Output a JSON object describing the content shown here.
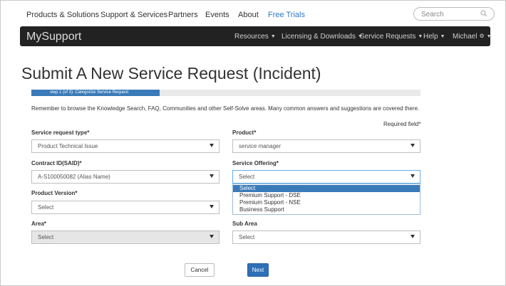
{
  "top_nav": {
    "items": [
      "Products & Solutions",
      "Support & Services",
      "Partners",
      "Events",
      "About",
      "Free Trials"
    ],
    "search_placeholder": "Search",
    "search_icon": "search-icon",
    "accent_color": "#2b78c5"
  },
  "app_bar": {
    "brand": "MySupport",
    "menus": [
      "Resources",
      "Licensing & Downloads",
      "Service Requests",
      "Help",
      "Michael"
    ],
    "user_icon": "gear-icon"
  },
  "page": {
    "title": "Submit A New Service Request (Incident)",
    "step_label": "step 1 (of 3): Categorize Service Request",
    "progress_fraction": 0.33,
    "notice": "Remember to browse the Knowledge Search, FAQ, Communities and other Self-Solve areas. Many common answers and suggestions are covered there.",
    "required_note": "Required field*"
  },
  "form": {
    "service_request_type": {
      "label": "Service request type*",
      "value": "Product Technical Issue"
    },
    "product": {
      "label": "Product*",
      "value": "service manager"
    },
    "contract_id": {
      "label": "Contract ID(SAID)*",
      "value": "A-S100050082 (Alias Name)"
    },
    "service_offering": {
      "label": "Service Offering*",
      "value": "Select",
      "options": [
        "Select",
        "Premium Support - DSE",
        "Premium Support - NSE",
        "Business Support"
      ],
      "highlighted_index": 0
    },
    "product_version": {
      "label": "Product Version*",
      "value": "Select"
    },
    "area": {
      "label": "Area*",
      "value": "Select"
    },
    "sub_area": {
      "label": "Sub Area",
      "value": "Select"
    }
  },
  "buttons": {
    "cancel": "Cancel",
    "next": "Next"
  }
}
